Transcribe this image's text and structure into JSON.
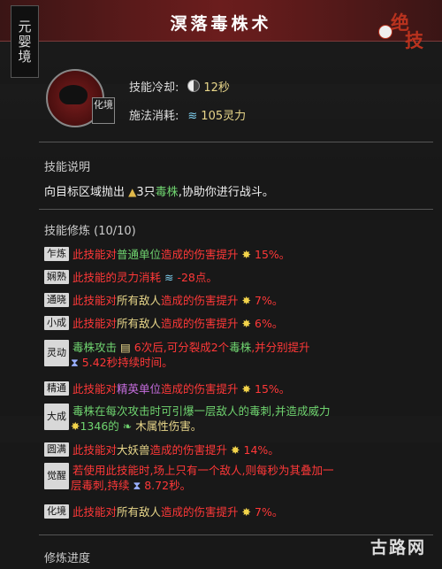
{
  "header": {
    "title": "溟落毒株术",
    "realm_tag": "元婴境",
    "ult_badge": [
      "绝",
      "技"
    ]
  },
  "skill": {
    "realm_small": "化境",
    "cooldown_label": "技能冷却:",
    "cooldown_value": "12秒",
    "cost_label": "施法消耗:",
    "cost_value": "105灵力"
  },
  "description": {
    "title": "技能说明",
    "text_pre": "向目标区域抛出",
    "count": "3只",
    "highlight": "毒株",
    "text_post": ",协助你进行战斗。"
  },
  "cultivation": {
    "title": "技能修炼 (10/10)",
    "rows": [
      {
        "tag": "乍炼",
        "pre": "此技能对",
        "hl": "普通单位",
        "post": "造成的伤害提升",
        "val": "15%。"
      },
      {
        "tag": "娴熟",
        "pre": "此技能的灵力消耗",
        "val": "-28点。"
      },
      {
        "tag": "通晓",
        "pre": "此技能对",
        "hl": "所有敌人",
        "post": "造成的伤害提升",
        "val": "7%。"
      },
      {
        "tag": "小成",
        "pre": "此技能对",
        "hl": "所有敌人",
        "post": "造成的伤害提升",
        "val": "6%。"
      },
      {
        "tag": "灵动",
        "l1a": "毒株攻击",
        "l1b": "6次后,可分裂成2个",
        "l1c": "毒株",
        "l1d": ",并分别提升",
        "l2": "5.42秒持续时间。"
      },
      {
        "tag": "精通",
        "pre": "此技能对",
        "hl": "精英单位",
        "post": "造成的伤害提升",
        "val": "15%。"
      },
      {
        "tag": "大成",
        "l1": "毒株在每次攻击时可引爆一层敌人的毒刺,并造成威力",
        "l2a": "1346的",
        "l2b": "木属性伤害。"
      },
      {
        "tag": "圆满",
        "pre": "此技能对",
        "hl": "大妖兽",
        "post": "造成的伤害提升",
        "val": "14%。"
      },
      {
        "tag": "觉醒",
        "l1": "若使用此技能时,场上只有一个敌人,则每秒为其叠加一",
        "l2a": "层毒刺,持续",
        "l2b": "8.72秒。"
      },
      {
        "tag": "化境",
        "pre": "此技能对",
        "hl": "所有敌人",
        "post": "造成的伤害提升",
        "val": "7%。"
      }
    ]
  },
  "footer": {
    "title": "修炼进度",
    "watermark": "古路网"
  }
}
